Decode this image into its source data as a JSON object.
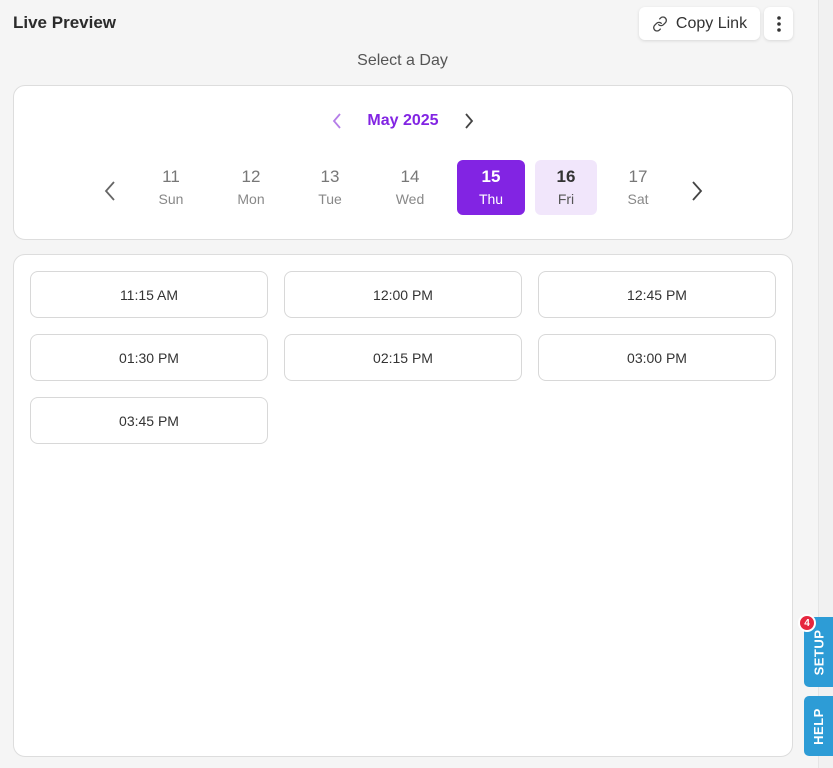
{
  "header": {
    "title": "Live Preview",
    "copy_link_label": "Copy Link",
    "copy_link_icon": "link-icon",
    "more_icon": "more-vertical-icon"
  },
  "picker": {
    "prompt": "Select a Day",
    "month_label": "May 2025",
    "days": [
      {
        "num": "11",
        "weekday": "Sun"
      },
      {
        "num": "12",
        "weekday": "Mon"
      },
      {
        "num": "13",
        "weekday": "Tue"
      },
      {
        "num": "14",
        "weekday": "Wed"
      },
      {
        "num": "15",
        "weekday": "Thu"
      },
      {
        "num": "16",
        "weekday": "Fri"
      },
      {
        "num": "17",
        "weekday": "Sat"
      }
    ],
    "selected_day": "15"
  },
  "slots": [
    "11:15 AM",
    "12:00 PM",
    "12:45 PM",
    "01:30 PM",
    "02:15 PM",
    "03:00 PM",
    "03:45 PM"
  ],
  "side_tabs": {
    "setup_label": "SETUP",
    "setup_badge": "4",
    "help_label": "HELP"
  },
  "colors": {
    "accent": "#8224e3",
    "accent_soft": "#f1e6fb",
    "side_tab": "#2d9cd6",
    "badge": "#e6263e"
  }
}
